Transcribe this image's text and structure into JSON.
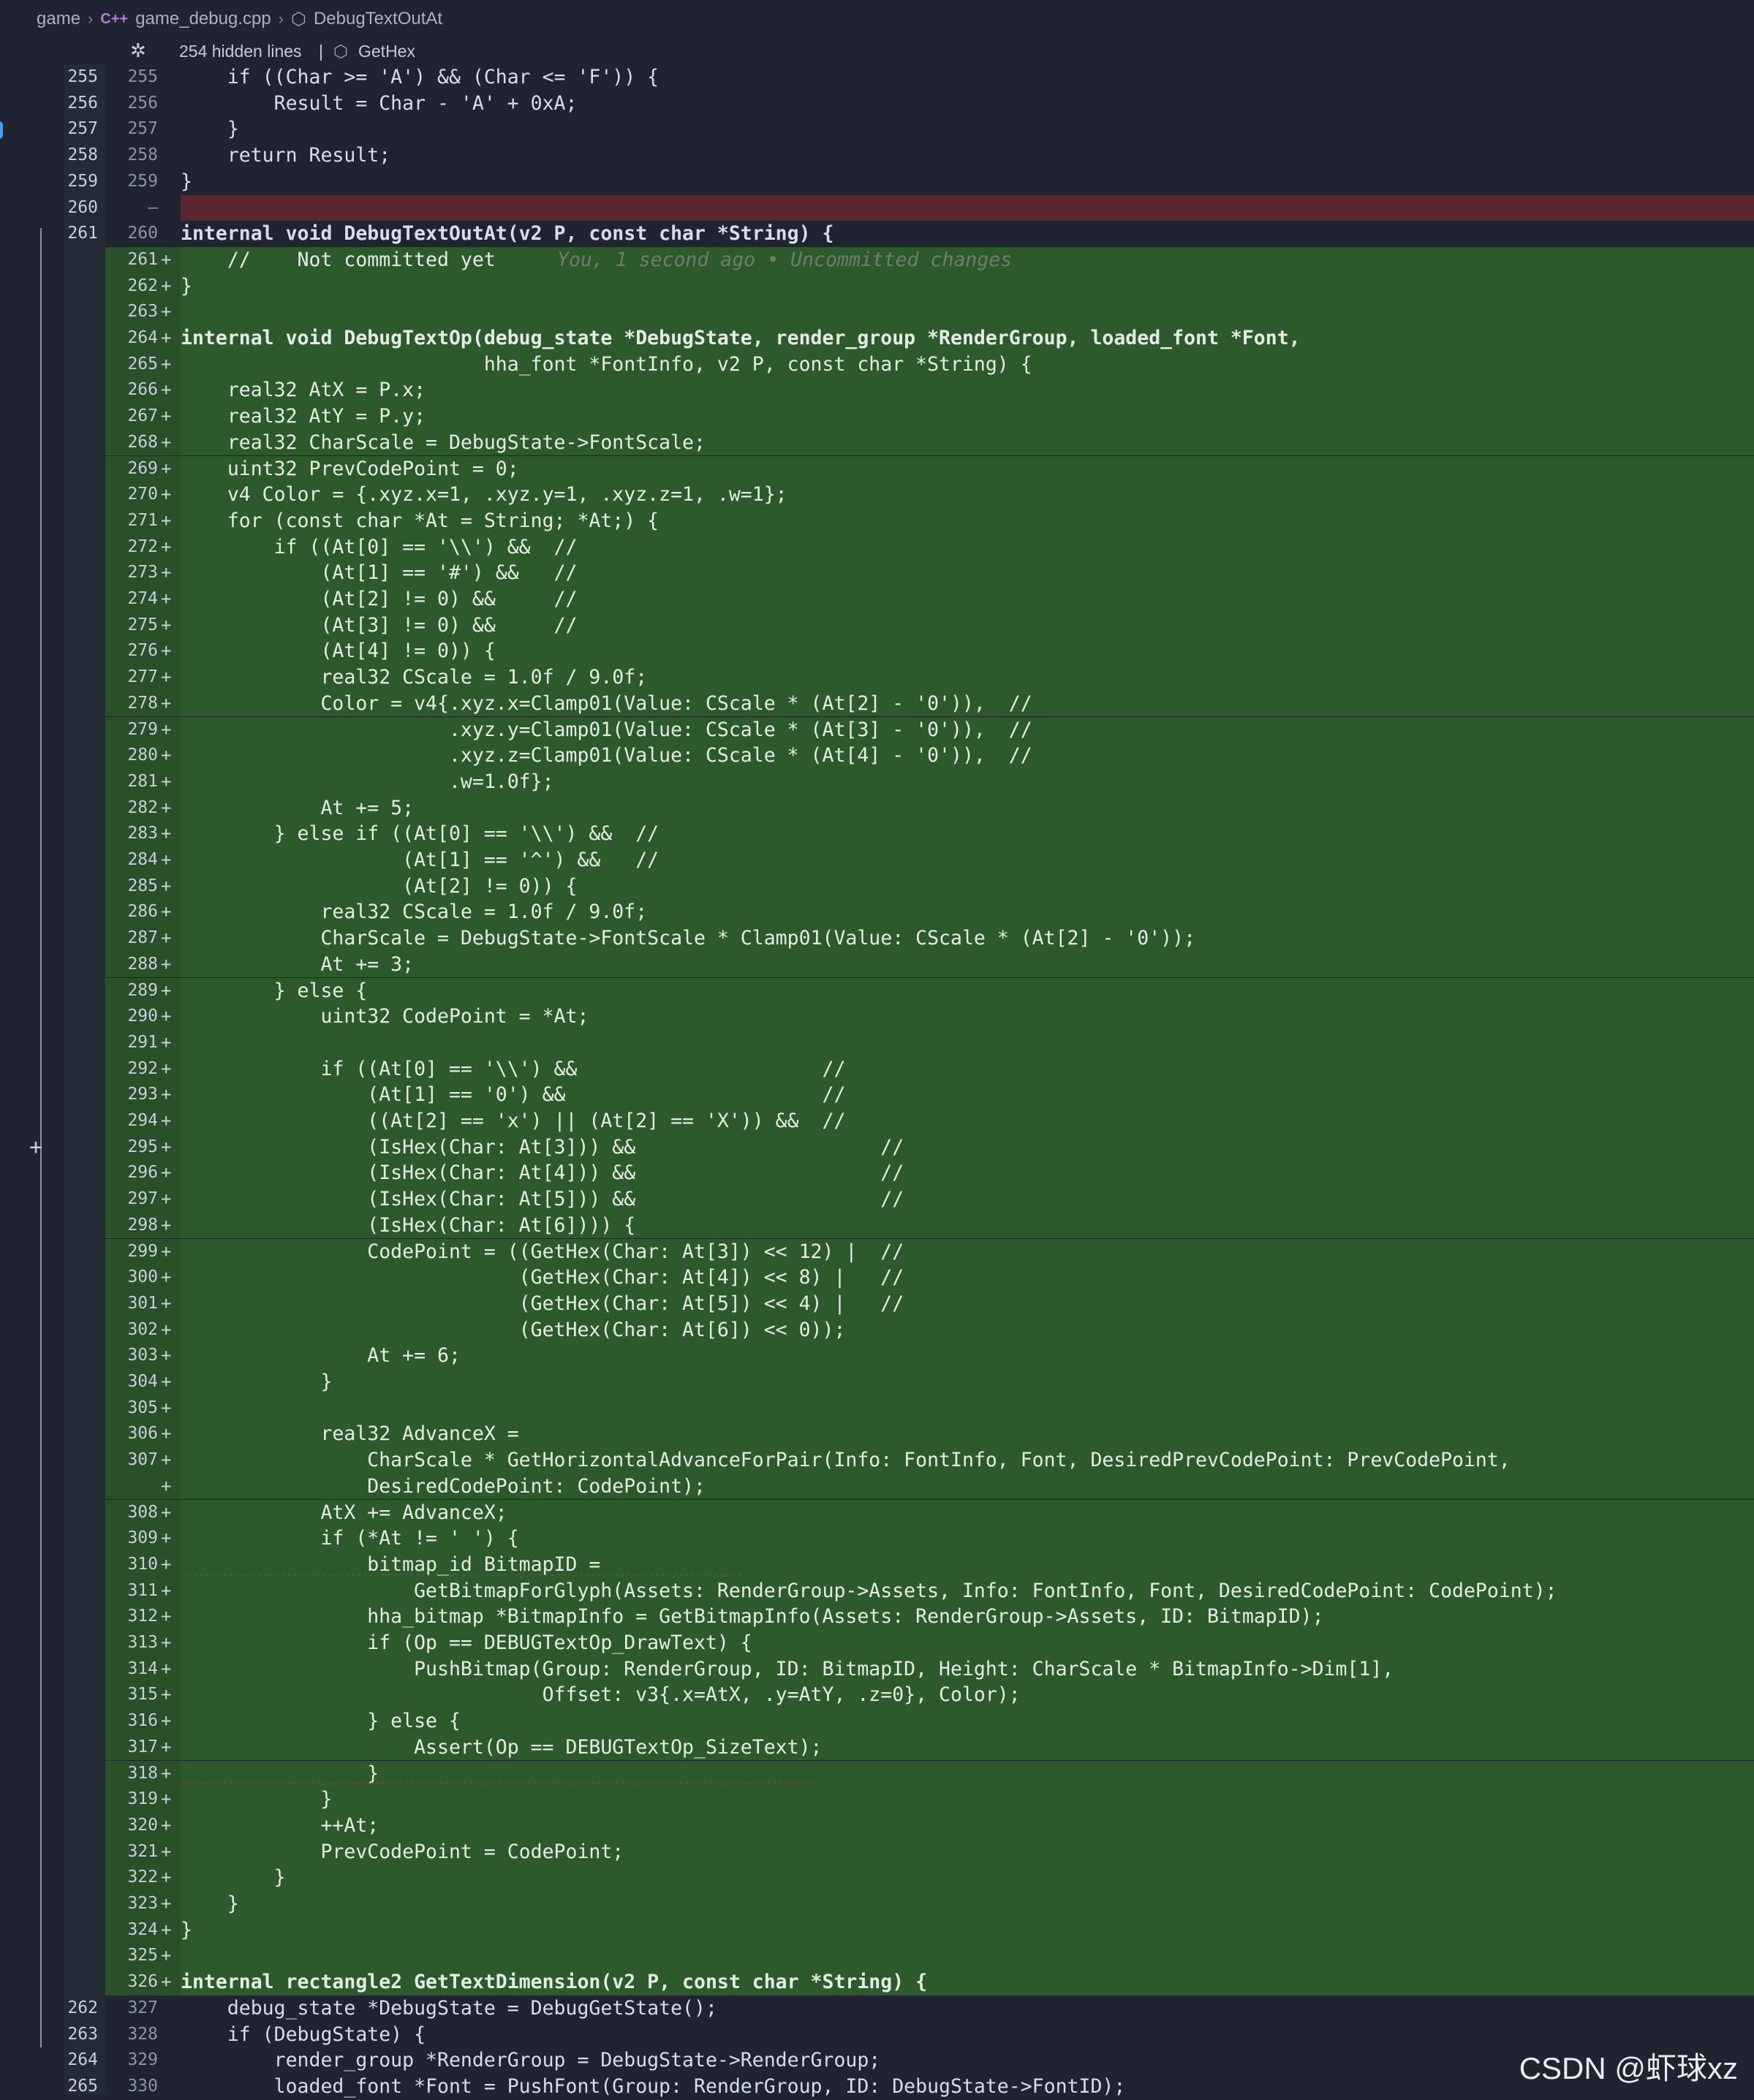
{
  "breadcrumb": {
    "folder": "game",
    "file_icon": "C++",
    "file": "game_debug.cpp",
    "symbol": "DebugTextOutAt"
  },
  "hidden": {
    "label": "254 hidden lines",
    "separator": "|",
    "symbol": "GetHex"
  },
  "blame": {
    "text": "You, 1 second ago • Uncommitted changes"
  },
  "lines": [
    {
      "a": "255",
      "b": "255",
      "t": "n",
      "code": "    if ((Char >= 'A') && (Char <= 'F')) {"
    },
    {
      "a": "256",
      "b": "256",
      "t": "n",
      "code": "        Result = Char - 'A' + 0xA;"
    },
    {
      "a": "257",
      "b": "257",
      "t": "n",
      "code": "    }"
    },
    {
      "a": "258",
      "b": "258",
      "t": "n",
      "code": "    return Result;"
    },
    {
      "a": "259",
      "b": "259",
      "t": "n",
      "code": "}"
    },
    {
      "a": "260",
      "b": "—",
      "t": "r",
      "code": ""
    },
    {
      "a": "261",
      "b": "260",
      "t": "n",
      "code": "internal void DebugTextOutAt(v2 P, const char *String) {"
    },
    {
      "a": "",
      "b": "261",
      "t": "g",
      "code": "    //    Not committed yet"
    },
    {
      "a": "",
      "b": "262",
      "t": "g",
      "code": "}"
    },
    {
      "a": "",
      "b": "263",
      "t": "g",
      "code": ""
    },
    {
      "a": "",
      "b": "264",
      "t": "g",
      "code": "internal void DebugTextOp(debug_state *DebugState, render_group *RenderGroup, loaded_font *Font,"
    },
    {
      "a": "",
      "b": "265",
      "t": "g",
      "code": "                          hha_font *FontInfo, v2 P, const char *String) {"
    },
    {
      "a": "",
      "b": "266",
      "t": "g",
      "code": "    real32 AtX = P.x;"
    },
    {
      "a": "",
      "b": "267",
      "t": "g",
      "code": "    real32 AtY = P.y;"
    },
    {
      "a": "",
      "b": "268",
      "t": "g",
      "code": "    real32 CharScale = DebugState->FontScale;"
    },
    {
      "a": "",
      "b": "269",
      "t": "g",
      "code": "    uint32 PrevCodePoint = 0;"
    },
    {
      "a": "",
      "b": "270",
      "t": "g",
      "code": "    v4 Color = {.xyz.x=1, .xyz.y=1, .xyz.z=1, .w=1};"
    },
    {
      "a": "",
      "b": "271",
      "t": "g",
      "code": "    for (const char *At = String; *At;) {"
    },
    {
      "a": "",
      "b": "272",
      "t": "g",
      "code": "        if ((At[0] == '\\\\') &&  //"
    },
    {
      "a": "",
      "b": "273",
      "t": "g",
      "code": "            (At[1] == '#') &&   //"
    },
    {
      "a": "",
      "b": "274",
      "t": "g",
      "code": "            (At[2] != 0) &&     //"
    },
    {
      "a": "",
      "b": "275",
      "t": "g",
      "code": "            (At[3] != 0) &&     //"
    },
    {
      "a": "",
      "b": "276",
      "t": "g",
      "code": "            (At[4] != 0)) {"
    },
    {
      "a": "",
      "b": "277",
      "t": "g",
      "code": "            real32 CScale = 1.0f / 9.0f;"
    },
    {
      "a": "",
      "b": "278",
      "t": "g",
      "code": "            Color = v4{.xyz.x=Clamp01(Value: CScale * (At[2] - '0')),  //"
    },
    {
      "a": "",
      "b": "279",
      "t": "g",
      "code": "                       .xyz.y=Clamp01(Value: CScale * (At[3] - '0')),  //"
    },
    {
      "a": "",
      "b": "280",
      "t": "g",
      "code": "                       .xyz.z=Clamp01(Value: CScale * (At[4] - '0')),  //"
    },
    {
      "a": "",
      "b": "281",
      "t": "g",
      "code": "                       .w=1.0f};"
    },
    {
      "a": "",
      "b": "282",
      "t": "g",
      "code": "            At += 5;"
    },
    {
      "a": "",
      "b": "283",
      "t": "g",
      "code": "        } else if ((At[0] == '\\\\') &&  //"
    },
    {
      "a": "",
      "b": "284",
      "t": "g",
      "code": "                   (At[1] == '^') &&   //"
    },
    {
      "a": "",
      "b": "285",
      "t": "g",
      "code": "                   (At[2] != 0)) {"
    },
    {
      "a": "",
      "b": "286",
      "t": "g",
      "code": "            real32 CScale = 1.0f / 9.0f;"
    },
    {
      "a": "",
      "b": "287",
      "t": "g",
      "code": "            CharScale = DebugState->FontScale * Clamp01(Value: CScale * (At[2] - '0'));"
    },
    {
      "a": "",
      "b": "288",
      "t": "g",
      "code": "            At += 3;"
    },
    {
      "a": "",
      "b": "289",
      "t": "g",
      "code": "        } else {"
    },
    {
      "a": "",
      "b": "290",
      "t": "g",
      "code": "            uint32 CodePoint = *At;"
    },
    {
      "a": "",
      "b": "291",
      "t": "g",
      "code": ""
    },
    {
      "a": "",
      "b": "292",
      "t": "g",
      "code": "            if ((At[0] == '\\\\') &&                     //"
    },
    {
      "a": "",
      "b": "293",
      "t": "g",
      "code": "                (At[1] == '0') &&                      //"
    },
    {
      "a": "",
      "b": "294",
      "t": "g",
      "code": "                ((At[2] == 'x') || (At[2] == 'X')) &&  //"
    },
    {
      "a": "",
      "b": "295",
      "t": "g",
      "code": "                (IsHex(Char: At[3])) &&                     //"
    },
    {
      "a": "",
      "b": "296",
      "t": "g",
      "code": "                (IsHex(Char: At[4])) &&                     //"
    },
    {
      "a": "",
      "b": "297",
      "t": "g",
      "code": "                (IsHex(Char: At[5])) &&                     //"
    },
    {
      "a": "",
      "b": "298",
      "t": "g",
      "code": "                (IsHex(Char: At[6]))) {"
    },
    {
      "a": "",
      "b": "299",
      "t": "g",
      "code": "                CodePoint = ((GetHex(Char: At[3]) << 12) |  //"
    },
    {
      "a": "",
      "b": "300",
      "t": "g",
      "code": "                             (GetHex(Char: At[4]) << 8) |   //"
    },
    {
      "a": "",
      "b": "301",
      "t": "g",
      "code": "                             (GetHex(Char: At[5]) << 4) |   //"
    },
    {
      "a": "",
      "b": "302",
      "t": "g",
      "code": "                             (GetHex(Char: At[6]) << 0));"
    },
    {
      "a": "",
      "b": "303",
      "t": "g",
      "code": "                At += 6;"
    },
    {
      "a": "",
      "b": "304",
      "t": "g",
      "code": "            }"
    },
    {
      "a": "",
      "b": "305",
      "t": "g",
      "code": ""
    },
    {
      "a": "",
      "b": "306",
      "t": "g",
      "code": "            real32 AdvanceX ="
    },
    {
      "a": "",
      "b": "307",
      "t": "g",
      "code": "                CharScale * GetHorizontalAdvanceForPair(Info: FontInfo, Font, DesiredPrevCodePoint: PrevCodePoint,"
    },
    {
      "a": "",
      "b": "",
      "t": "g",
      "code": "                DesiredCodePoint: CodePoint);"
    },
    {
      "a": "",
      "b": "308",
      "t": "g",
      "code": "            AtX += AdvanceX;"
    },
    {
      "a": "",
      "b": "309",
      "t": "g",
      "code": "            if (*At != ' ') {"
    },
    {
      "a": "",
      "b": "310",
      "t": "g",
      "code": "                bitmap_id BitmapID ="
    },
    {
      "a": "",
      "b": "311",
      "t": "g",
      "code": "                    GetBitmapForGlyph(Assets: RenderGroup->Assets, Info: FontInfo, Font, DesiredCodePoint: CodePoint);"
    },
    {
      "a": "",
      "b": "312",
      "t": "g",
      "code": "                hha_bitmap *BitmapInfo = GetBitmapInfo(Assets: RenderGroup->Assets, ID: BitmapID);"
    },
    {
      "a": "",
      "b": "313",
      "t": "g",
      "code": "                if (Op == DEBUGTextOp_DrawText) {"
    },
    {
      "a": "",
      "b": "314",
      "t": "g",
      "code": "                    PushBitmap(Group: RenderGroup, ID: BitmapID, Height: CharScale * BitmapInfo->Dim[1],"
    },
    {
      "a": "",
      "b": "315",
      "t": "g",
      "code": "                               Offset: v3{.x=AtX, .y=AtY, .z=0}, Color);"
    },
    {
      "a": "",
      "b": "316",
      "t": "g",
      "code": "                } else {"
    },
    {
      "a": "",
      "b": "317",
      "t": "g",
      "code": "                    Assert(Op == DEBUGTextOp_SizeText);"
    },
    {
      "a": "",
      "b": "318",
      "t": "g",
      "code": "                }"
    },
    {
      "a": "",
      "b": "319",
      "t": "g",
      "code": "            }"
    },
    {
      "a": "",
      "b": "320",
      "t": "g",
      "code": "            ++At;"
    },
    {
      "a": "",
      "b": "321",
      "t": "g",
      "code": "            PrevCodePoint = CodePoint;"
    },
    {
      "a": "",
      "b": "322",
      "t": "g",
      "code": "        }"
    },
    {
      "a": "",
      "b": "323",
      "t": "g",
      "code": "    }"
    },
    {
      "a": "",
      "b": "324",
      "t": "g",
      "code": "}"
    },
    {
      "a": "",
      "b": "325",
      "t": "g",
      "code": ""
    },
    {
      "a": "",
      "b": "326",
      "t": "g",
      "code": "internal rectangle2 GetTextDimension(v2 P, const char *String) {"
    },
    {
      "a": "262",
      "b": "327",
      "t": "n",
      "code": "    debug_state *DebugState = DebugGetState();"
    },
    {
      "a": "263",
      "b": "328",
      "t": "n",
      "code": "    if (DebugState) {"
    },
    {
      "a": "264",
      "b": "329",
      "t": "n",
      "code": "        render_group *RenderGroup = DebugState->RenderGroup;"
    },
    {
      "a": "265",
      "b": "330",
      "t": "n",
      "code": "        loaded_font *Font = PushFont(Group: RenderGroup, ID: DebugState->FontID);"
    }
  ],
  "watermark": "CSDN @虾球xz",
  "colors": {
    "added_bg": "#2d5a2d",
    "removed_bg": "#5c2630",
    "editor_bg": "#1f2430",
    "keyword": "#3fa3ff",
    "type": "#7fa1b6",
    "string": "#e6ebe6",
    "number": "#7fd1ff",
    "function": "#ffffff"
  },
  "icons": {
    "cpp": "cpp-file-icon",
    "symbol": "cube-icon",
    "hidden": "unfold-icon",
    "gutter": "plus-icon"
  }
}
